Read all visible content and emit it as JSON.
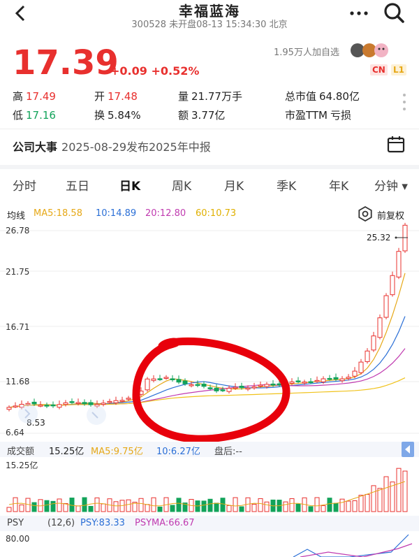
{
  "header": {
    "title": "幸福蓝海",
    "subtitle": "300528 未开盘08-13 15:34:30 北京"
  },
  "quote": {
    "price": "17.39",
    "change": "+0.09 +0.52%",
    "followers": "1.95万人加自选",
    "badge_cn": "CN",
    "badge_l1": "L1"
  },
  "stats": {
    "high_label": "高",
    "high_value": "17.49",
    "open_label": "开",
    "open_value": "17.48",
    "volume_label": "量",
    "volume_value": "21.77万手",
    "mcap_label": "总市值",
    "mcap_value": "64.80亿",
    "low_label": "低",
    "low_value": "17.16",
    "turnover_label": "换",
    "turnover_value": "5.84%",
    "amount_label": "额",
    "amount_value": "3.77亿",
    "pe_label": "市盈TTM",
    "pe_value": "亏损"
  },
  "event": {
    "label": "公司大事",
    "text": "2025-08-29发布2025年中报"
  },
  "tabs": [
    {
      "label": "分时"
    },
    {
      "label": "五日"
    },
    {
      "label": "日K"
    },
    {
      "label": "周K"
    },
    {
      "label": "月K"
    },
    {
      "label": "季K"
    },
    {
      "label": "年K"
    },
    {
      "label": "分钟 ▾"
    }
  ],
  "ma": {
    "label": "均线",
    "ma5": "MA5:18.58",
    "ma10": "10:14.89",
    "ma20": "20:12.80",
    "ma60": "60:10.73",
    "adjust": "前复权"
  },
  "price_axis": [
    "26.78",
    "21.75",
    "16.71",
    "11.68",
    "6.64"
  ],
  "annotations": {
    "high_tag": "25.32",
    "low_tag": "8.53"
  },
  "volume": {
    "label": "成交额",
    "value": "15.25亿",
    "ma5": "MA5:9.75亿",
    "ma10": "10:6.27亿",
    "after": "盘后:--",
    "axis_top": "15.25亿"
  },
  "psy": {
    "label": "PSY",
    "params": "(12,6)",
    "psy": "PSY:83.33",
    "psyma": "PSYMA:66.67",
    "axis_top": "80.00"
  },
  "colors": {
    "up": "#e8302e",
    "down": "#12a35a",
    "ma5": "#e6a817",
    "ma10": "#2b6fd6",
    "ma20": "#c03bb0",
    "ma60": "#f0c21a"
  }
}
